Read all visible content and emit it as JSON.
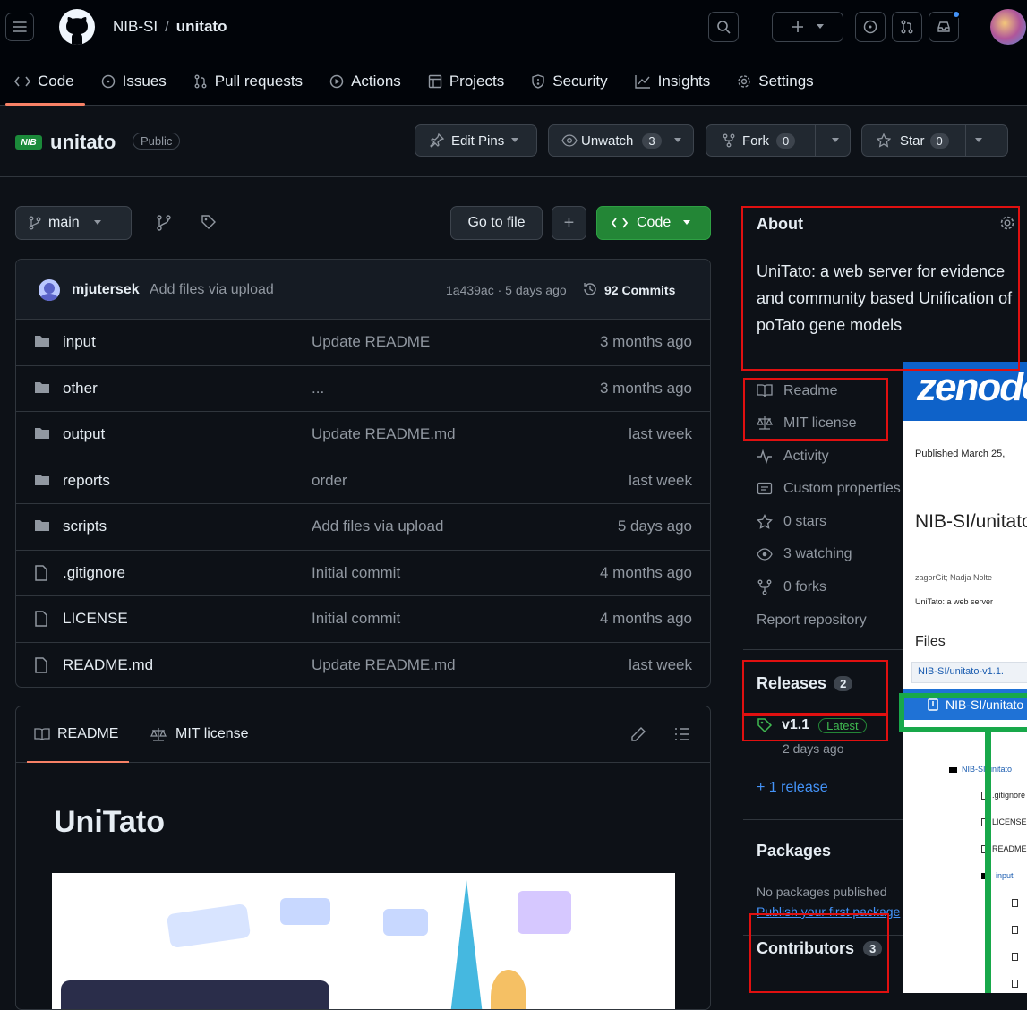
{
  "header": {
    "owner": "NIB-SI",
    "separator": "/",
    "repo": "unitato"
  },
  "tabs": [
    {
      "label": "Code",
      "icon": "code-icon"
    },
    {
      "label": "Issues",
      "icon": "issue-icon"
    },
    {
      "label": "Pull requests",
      "icon": "pull-request-icon"
    },
    {
      "label": "Actions",
      "icon": "play-icon"
    },
    {
      "label": "Projects",
      "icon": "table-icon"
    },
    {
      "label": "Security",
      "icon": "shield-icon"
    },
    {
      "label": "Insights",
      "icon": "graph-icon"
    },
    {
      "label": "Settings",
      "icon": "gear-icon"
    }
  ],
  "repo": {
    "logo_text": "NIB",
    "name": "unitato",
    "visibility": "Public",
    "edit_pins": "Edit Pins",
    "unwatch": "Unwatch",
    "watch_count": "3",
    "fork": "Fork",
    "fork_count": "0",
    "star": "Star",
    "star_count": "0"
  },
  "toolbar": {
    "branch": "main",
    "go_to_file": "Go to file",
    "plus": "+",
    "code": "Code"
  },
  "commit": {
    "author": "mjutersek",
    "message": "Add files via upload",
    "hash_time": "1a439ac · 5 days ago",
    "commits": "92 Commits"
  },
  "files": [
    {
      "type": "dir",
      "name": "input",
      "message": "Update README",
      "age": "3 months ago"
    },
    {
      "type": "dir",
      "name": "other",
      "message": "...",
      "age": "3 months ago"
    },
    {
      "type": "dir",
      "name": "output",
      "message": "Update README.md",
      "age": "last week"
    },
    {
      "type": "dir",
      "name": "reports",
      "message": "order",
      "age": "last week"
    },
    {
      "type": "dir",
      "name": "scripts",
      "message": "Add files via upload",
      "age": "5 days ago"
    },
    {
      "type": "file",
      "name": ".gitignore",
      "message": "Initial commit",
      "age": "4 months ago"
    },
    {
      "type": "file",
      "name": "LICENSE",
      "message": "Initial commit",
      "age": "4 months ago"
    },
    {
      "type": "file",
      "name": "README.md",
      "message": "Update README.md",
      "age": "last week"
    }
  ],
  "readme": {
    "tab_readme": "README",
    "tab_license": "MIT license",
    "heading": "UniTato"
  },
  "about": {
    "title": "About",
    "description": "UniTato: a web server for evidence and community based Unification of poTato gene models",
    "links": [
      {
        "label": "Readme",
        "icon": "book-icon"
      },
      {
        "label": "MIT license",
        "icon": "law-icon"
      },
      {
        "label": "Activity",
        "icon": "pulse-icon"
      },
      {
        "label": "Custom properties",
        "icon": "note-icon"
      },
      {
        "label": "0 stars",
        "icon": "star-icon"
      },
      {
        "label": "3 watching",
        "icon": "eye-icon"
      },
      {
        "label": "0 forks",
        "icon": "fork-icon"
      }
    ],
    "report": "Report repository"
  },
  "releases": {
    "title": "Releases",
    "count": "2",
    "version": "v1.1",
    "badge": "Latest",
    "date": "2 days ago",
    "more": "+ 1 release"
  },
  "packages": {
    "title": "Packages",
    "none": "No packages published",
    "publish": "Publish your first package"
  },
  "contributors": {
    "title": "Contributors",
    "count": "3"
  },
  "zenodo": {
    "logo": "zenodo",
    "published": "Published March 25,",
    "title": "NIB-SI/unitato",
    "authors": "zagorGit;  Nadja Nolte",
    "desc": "UniTato: a web server",
    "files_title": "Files",
    "archive": "NIB-SI/unitato-v1.1.",
    "selected": "NIB-SI/unitato",
    "tree_root": "NIB-SI/unitato",
    "tree_items": [
      ".gitignore",
      "LICENSE",
      "README.md",
      "input"
    ]
  },
  "colors": {
    "accent_green": "#238636",
    "tab_underline": "#f78166",
    "link": "#4493f8",
    "annotation_red": "#e01010",
    "annotation_green": "#18a84a"
  }
}
